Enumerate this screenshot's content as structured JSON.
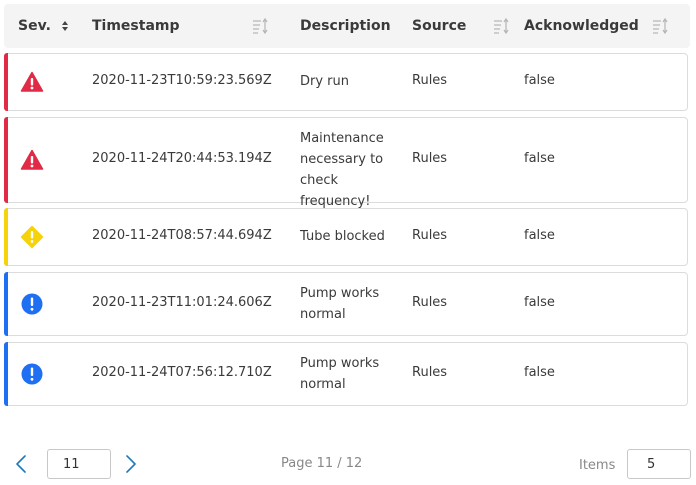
{
  "colors": {
    "critical": "#e02a46",
    "warning": "#f5d20a",
    "info": "#1e6ff1",
    "accent": "#1b7ac0"
  },
  "table": {
    "headers": {
      "severity": "Sev.",
      "timestamp": "Timestamp",
      "description": "Description",
      "source": "Source",
      "acknowledged": "Acknowledged"
    },
    "rows": [
      {
        "severity": "critical",
        "severity_icon": "alarm-triangle-icon",
        "timestamp": "2020-11-23T10:59:23.569Z",
        "description": "Dry run",
        "source": "Rules",
        "acknowledged": "false"
      },
      {
        "severity": "critical",
        "severity_icon": "alarm-triangle-icon",
        "timestamp": "2020-11-24T20:44:53.194Z",
        "description": "Maintenance necessary to check frequency!",
        "source": "Rules",
        "acknowledged": "false"
      },
      {
        "severity": "warning",
        "severity_icon": "warning-diamond-icon",
        "timestamp": "2020-11-24T08:57:44.694Z",
        "description": "Tube blocked",
        "source": "Rules",
        "acknowledged": "false"
      },
      {
        "severity": "info",
        "severity_icon": "info-circle-icon",
        "timestamp": "2020-11-23T11:01:24.606Z",
        "description": "Pump works normal",
        "source": "Rules",
        "acknowledged": "false"
      },
      {
        "severity": "info",
        "severity_icon": "info-circle-icon",
        "timestamp": "2020-11-24T07:56:12.710Z",
        "description": "Pump works normal",
        "source": "Rules",
        "acknowledged": "false"
      }
    ]
  },
  "pagination": {
    "current_page": "11",
    "page_info": "Page 11 / 12",
    "items_label": "Items",
    "items_per_page": "5"
  }
}
